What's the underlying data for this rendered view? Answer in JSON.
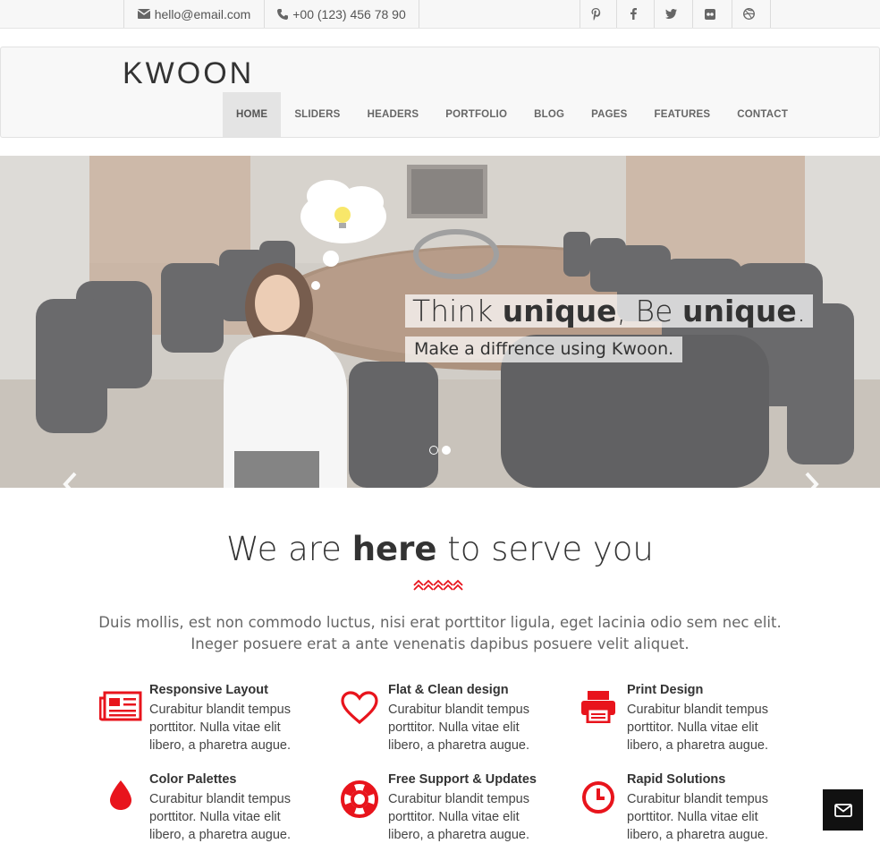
{
  "topbar": {
    "email": "hello@email.com",
    "phone": "+00 (123) 456 78 90",
    "social": [
      "pinterest-icon",
      "facebook-icon",
      "twitter-icon",
      "flickr-icon",
      "dribbble-icon"
    ]
  },
  "brand": {
    "logo": "KWOON"
  },
  "nav": {
    "items": [
      {
        "label": "HOME"
      },
      {
        "label": "SLIDERS"
      },
      {
        "label": "HEADERS"
      },
      {
        "label": "PORTFOLIO"
      },
      {
        "label": "BLOG"
      },
      {
        "label": "PAGES"
      },
      {
        "label": "FEATURES"
      },
      {
        "label": "CONTACT"
      }
    ]
  },
  "hero": {
    "caption_part1": "Think ",
    "caption_bold1": "unique",
    "caption_part2": ", Be ",
    "caption_bold2": "unique",
    "caption_part3": ".",
    "subcaption": "Make a diffrence using Kwoon.",
    "slides_total": 2,
    "active_slide": 2
  },
  "section": {
    "title_part1": "We are ",
    "title_bold": "here",
    "title_part2": " to serve you",
    "text": "Duis mollis, est non commodo luctus, nisi erat porttitor ligula, eget lacinia odio sem nec elit. Ineger posuere erat a ante venenatis dapibus posuere velit aliquet.",
    "accent": "#e8141c"
  },
  "features": [
    {
      "title": "Responsive Layout",
      "text": "Curabitur blandit tempus porttitor. Nulla vitae elit libero, a pharetra augue.",
      "icon": "newspaper-icon"
    },
    {
      "title": "Flat & Clean design",
      "text": "Curabitur blandit tempus porttitor. Nulla vitae elit libero, a pharetra augue.",
      "icon": "heart-icon"
    },
    {
      "title": "Print Design",
      "text": "Curabitur blandit tempus porttitor. Nulla vitae elit libero, a pharetra augue.",
      "icon": "printer-icon"
    },
    {
      "title": "Color Palettes",
      "text": "Curabitur blandit tempus porttitor. Nulla vitae elit libero, a pharetra augue.",
      "icon": "drop-icon"
    },
    {
      "title": "Free Support & Updates",
      "text": "Curabitur blandit tempus porttitor. Nulla vitae elit libero, a pharetra augue.",
      "icon": "lifebuoy-icon"
    },
    {
      "title": "Rapid Solutions",
      "text": "Curabitur blandit tempus porttitor. Nulla vitae elit libero, a pharetra augue.",
      "icon": "clock-icon"
    }
  ]
}
